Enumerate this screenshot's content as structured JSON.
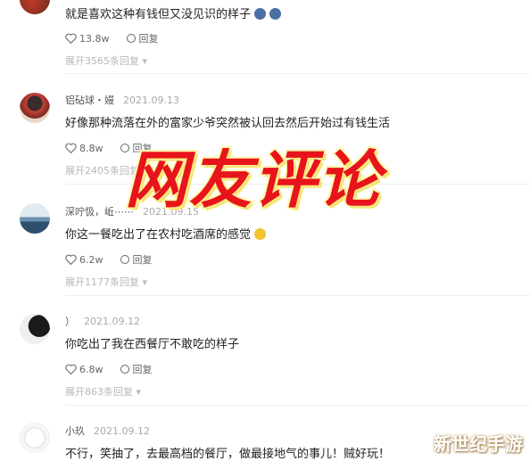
{
  "comments": [
    {
      "username": "",
      "date": "",
      "text": "就是喜欢这种有钱但又没见识的样子",
      "likes": "13.8w",
      "reply_label": "回复",
      "expand": "展开3565条回复"
    },
    {
      "username": "铝砧球・嫚",
      "date": "2021.09.13",
      "text": "好像那种流落在外的富家少爷突然被认回去然后开始过有钱生活",
      "likes": "8.8w",
      "reply_label": "回复",
      "expand": "展开2405条回复"
    },
    {
      "username": "深咛忣，岴⋯⋯",
      "date": "2021.09.15",
      "text": "你这一餐吃出了在农村吃酒席的感觉",
      "likes": "6.2w",
      "reply_label": "回复",
      "expand": "展开1177条回复"
    },
    {
      "username": "）",
      "date": "2021.09.12",
      "text": "你吃出了我在西餐厅不敢吃的样子",
      "likes": "6.8w",
      "reply_label": "回复",
      "expand": "展开863条回复"
    },
    {
      "username": "小玖",
      "date": "2021.09.12",
      "text": "不行，笑抽了，去最高档的餐厅，做最接地气的事儿！贼好玩！"
    }
  ],
  "overlay_title": "网友评论",
  "watermark": "新世纪手游",
  "colors": {
    "overlay_red": "#e8141b",
    "overlay_outline": "#fff7a8"
  }
}
